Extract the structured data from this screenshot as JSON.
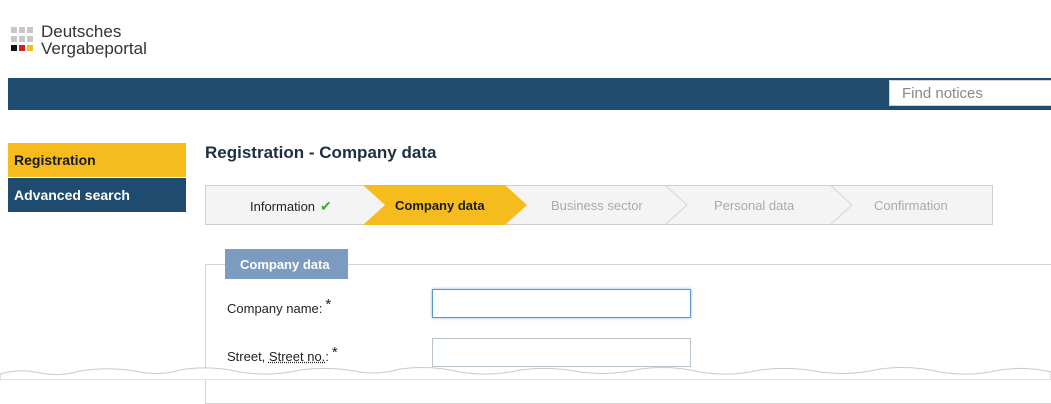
{
  "brand": {
    "line1": "Deutsches",
    "line2": "Vergabeportal"
  },
  "search": {
    "placeholder": "Find notices",
    "value": ""
  },
  "sidebar": {
    "items": [
      {
        "label": "Registration",
        "active": true
      },
      {
        "label": "Advanced search",
        "active": false
      }
    ]
  },
  "main": {
    "title": "Registration - Company data",
    "steps": [
      {
        "label": "Information",
        "state": "done",
        "icon": "checkmark-icon"
      },
      {
        "label": "Company data",
        "state": "active"
      },
      {
        "label": "Business sector",
        "state": "pending"
      },
      {
        "label": "Personal data",
        "state": "pending"
      },
      {
        "label": "Confirmation",
        "state": "pending"
      }
    ],
    "section": {
      "legend": "Company data",
      "fields": [
        {
          "label": "Company name:",
          "required_mark": "*",
          "value": ""
        },
        {
          "label_prefix": "Street, ",
          "label_abbr": "Street no.",
          "label_suffix": ":",
          "required_mark": "*",
          "value": ""
        }
      ]
    }
  },
  "colors": {
    "accent_yellow": "#f6bb1d",
    "navy": "#1e4b6e",
    "legend_blue": "#7b9cc0",
    "check_green": "#3daa3d"
  }
}
